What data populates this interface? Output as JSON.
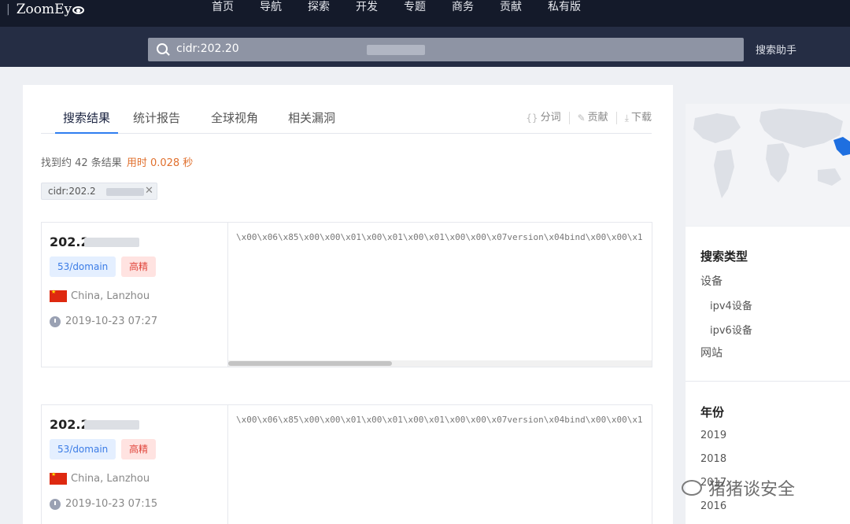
{
  "brand": {
    "name": "ZoomEy",
    "divider": "|"
  },
  "nav": {
    "items": [
      "首页",
      "导航",
      "探索",
      "开发",
      "专题",
      "商务",
      "贡献",
      "私有版"
    ]
  },
  "search": {
    "value": "cidr:202.20",
    "assistant_label": "搜索助手"
  },
  "tabs": [
    {
      "label": "搜索结果",
      "active": true
    },
    {
      "label": "统计报告",
      "active": false
    },
    {
      "label": "全球视角",
      "active": false
    },
    {
      "label": "相关漏洞",
      "active": false
    }
  ],
  "tools": {
    "segment": "分词",
    "contribute": "贡献",
    "download": "下载"
  },
  "summary": {
    "found": "找到约 42 条结果",
    "time": "用时 0.028 秒"
  },
  "filter_chip": {
    "text": "cidr:202.2"
  },
  "results": [
    {
      "ip": "202.2",
      "service": "53/domain",
      "badge": "高精",
      "location": "China, Lanzhou",
      "timestamp": "2019-10-23 07:27",
      "banner": "\\x00\\x06\\x85\\x00\\x00\\x01\\x00\\x01\\x00\\x01\\x00\\x00\\x07version\\x04bind\\x00\\x00\\x1"
    },
    {
      "ip": "202.2",
      "service": "53/domain",
      "badge": "高精",
      "location": "China, Lanzhou",
      "timestamp": "2019-10-23 07:15",
      "banner": "\\x00\\x06\\x85\\x00\\x00\\x01\\x00\\x01\\x00\\x01\\x00\\x00\\x07version\\x04bind\\x00\\x00\\x1"
    }
  ],
  "sidebar": {
    "search_type": {
      "title": "搜索类型",
      "device": "设备",
      "ipv4": "ipv4设备",
      "ipv6": "ipv6设备",
      "website": "网站"
    },
    "year": {
      "title": "年份",
      "items": [
        "2019",
        "2018",
        "2017",
        "2016"
      ]
    }
  },
  "watermark": {
    "text": "猪猪谈安全"
  },
  "colors": {
    "nav_bg": "#141a2a",
    "search_band_bg": "#252d44",
    "accent": "#2f7ef0",
    "time_orange": "#e0702e",
    "tag_blue": "#3b7ce6",
    "tag_red": "#e0463c"
  }
}
